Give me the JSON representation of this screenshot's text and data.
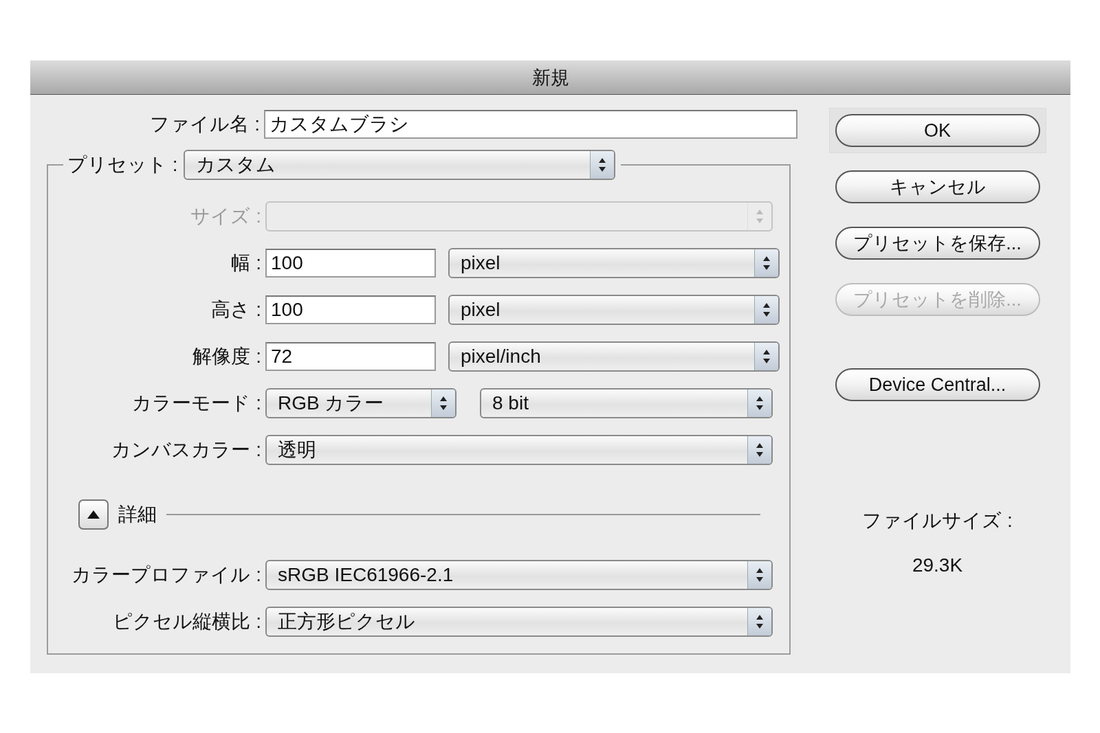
{
  "window": {
    "title": "新規"
  },
  "file_name": {
    "label": "ファイル名 :",
    "value": "カスタムブラシ"
  },
  "preset": {
    "label": "プリセット :",
    "value": "カスタム"
  },
  "fields": [
    {
      "kind": "select",
      "label": "サイズ :",
      "disabled": true
    },
    {
      "kind": "input-unit",
      "label": "幅 :",
      "value": "100",
      "unit": "pixel",
      "disabled": false
    },
    {
      "kind": "input-unit",
      "label": "高さ :",
      "value": "100",
      "unit": "pixel",
      "disabled": false
    },
    {
      "kind": "input-unit",
      "label": "解像度 :",
      "value": "72",
      "unit": "pixel/inch",
      "disabled": false
    },
    {
      "kind": "double-select",
      "label": "カラーモード :",
      "value": "RGB カラー",
      "value2": "8 bit",
      "disabled": false
    },
    {
      "kind": "select",
      "label": "カンバスカラー :",
      "value": "透明",
      "disabled": false
    }
  ],
  "details": {
    "label": "詳細",
    "expanded": true
  },
  "advanced_fields": [
    {
      "label": "カラープロファイル :",
      "value": "sRGB IEC61966-2.1"
    },
    {
      "label": "ピクセル縦横比 :",
      "value": "正方形ピクセル"
    }
  ],
  "buttons": [
    {
      "label": "OK",
      "default": true,
      "disabled": false
    },
    {
      "label": "キャンセル",
      "default": false,
      "disabled": false
    },
    {
      "label": "プリセットを保存...",
      "default": false,
      "disabled": false
    },
    {
      "label": "プリセットを削除...",
      "default": false,
      "disabled": true
    }
  ],
  "extra_buttons": [
    {
      "label": "Device Central...",
      "default": false,
      "disabled": false
    }
  ],
  "file_size": {
    "label": "ファイルサイズ :",
    "value": "29.3K"
  }
}
